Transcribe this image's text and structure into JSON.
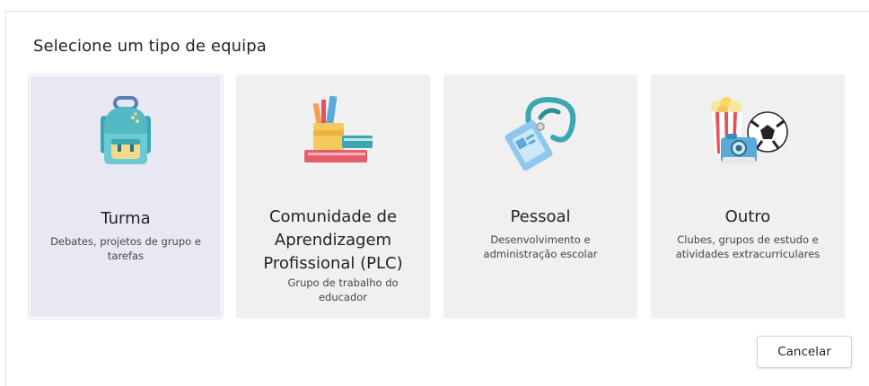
{
  "dialog": {
    "title": "Selecione um tipo de equipa",
    "cancel_label": "Cancelar"
  },
  "cards": [
    {
      "title": "Turma",
      "description": "Debates, projetos de grupo e tarefas",
      "icon": "backpack-icon",
      "selected": true
    },
    {
      "title": "Comunidade de Aprendizagem Profissional (PLC)",
      "description": "Grupo de trabalho do educador",
      "icon": "books-pencils-icon",
      "selected": false
    },
    {
      "title": "Pessoal",
      "description": "Desenvolvimento e administração escolar",
      "icon": "id-badge-lanyard-icon",
      "selected": false
    },
    {
      "title": "Outro",
      "description": "Clubes, grupos de estudo e atividades extracurriculares",
      "icon": "popcorn-camera-ball-icon",
      "selected": false
    }
  ],
  "colors": {
    "selected_card_bg": "#e8e8f3",
    "card_bg": "#f0f0f0",
    "text": "#252423"
  }
}
